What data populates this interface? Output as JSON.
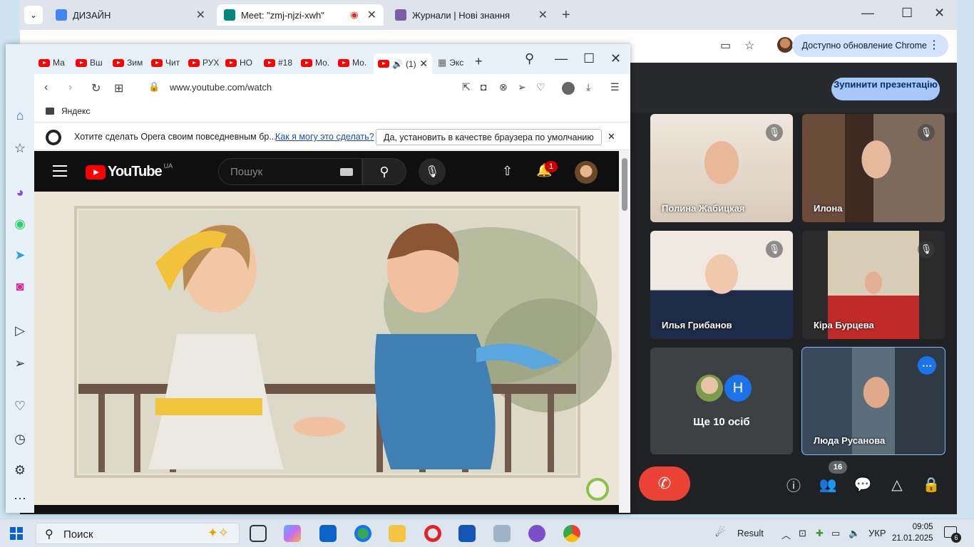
{
  "chrome": {
    "tabs": [
      {
        "label": "ДИЗАЙН",
        "color": "#4285f4"
      },
      {
        "label": "Meet: \"zmj-njzi-xwh\"",
        "color": "#00897b"
      },
      {
        "label": "Журнали | Нові знання",
        "color": "#7b5ea7"
      }
    ],
    "update_label": "Доступно обновление Chrome"
  },
  "meet": {
    "stop_presenting": "Зупинити презентацію",
    "participants": [
      {
        "name": "Полина Жабицкая"
      },
      {
        "name": "Илона"
      },
      {
        "name": "Илья Грибанов"
      },
      {
        "name": "Кіра Бурцева"
      },
      {
        "name": "Люда Русанова"
      }
    ],
    "others_label": "Ще 10 осіб",
    "others_initial": "Н",
    "people_count": "16"
  },
  "opera": {
    "tabs": [
      "Ма",
      "Вш",
      "Зим",
      "Чит",
      "РУХ",
      "НО",
      "#18",
      "Мо.",
      "Мо.",
      "(1)",
      "Экс"
    ],
    "url": "www.youtube.com/watch",
    "bookmark": "Яндекс",
    "infobar": {
      "text": "Хотите сделать Opera своим повседневным бр...",
      "link": "Как я могу это сделать?",
      "button": "Да, установить в качестве браузера по умолчанию"
    }
  },
  "youtube": {
    "logo": "YouTube",
    "country": "UA",
    "search_placeholder": "Пошук",
    "notifications": "1"
  },
  "taskbar": {
    "search_label": "Поиск",
    "weather_label": "Result",
    "language": "УКР",
    "time": "09:05",
    "date": "21.01.2025",
    "notification_count": "6"
  }
}
